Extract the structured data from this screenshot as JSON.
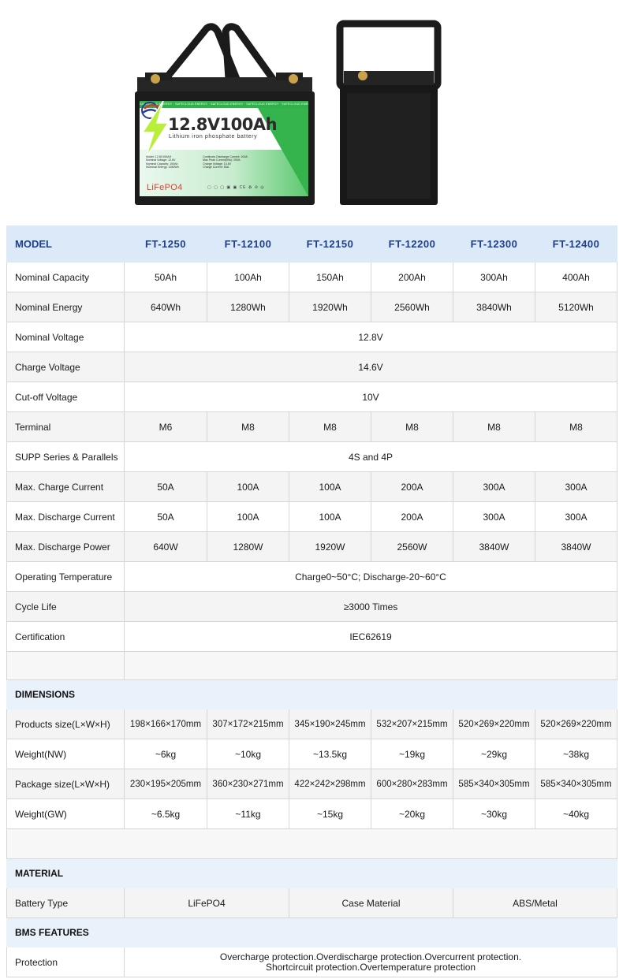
{
  "product": {
    "label_strip": "SAFECLOUD ENERGY · SAFECLOUD ENERGY · SAFECLOUD ENERGY · SAFECLOUD ENERGY · SAFECLOUD ENERGY · SAFECLOUD ENERGY",
    "title": "12.8V100Ah",
    "subtitle": "Lithium iron phosphate battery",
    "specs_left": [
      "Model:  12.8V100AH",
      "Nominal Voltage:  12.8V",
      "Nominal Capacity:  100Ah",
      "NOminal Energy:  1280Wh"
    ],
    "specs_right": [
      "Continues Discharge Current:  100A",
      "Max Peak Current(05s):  200A",
      "Charge Voltage:  14.6V",
      "Charge Current:  50A"
    ],
    "chemistry": "LiFePO4",
    "cert_marks": "▢ ▢ ▢  ▣ ▣ CE ♻ ⊘ ◎"
  },
  "header": {
    "label": "MODEL",
    "models": [
      "FT-1250",
      "FT-12100",
      "FT-12150",
      "FT-12200",
      "FT-12300",
      "FT-12400"
    ]
  },
  "rows": [
    {
      "label": "Nominal Capacity",
      "values": [
        "50Ah",
        "100Ah",
        "150Ah",
        "200Ah",
        "300Ah",
        "400Ah"
      ]
    },
    {
      "label": "Nominal Energy",
      "values": [
        "640Wh",
        "1280Wh",
        "1920Wh",
        "2560Wh",
        "3840Wh",
        "5120Wh"
      ]
    },
    {
      "label": "Nominal Voltage",
      "value": "12.8V"
    },
    {
      "label": "Charge Voltage",
      "value": "14.6V"
    },
    {
      "label": "Cut-off Voltage",
      "value": "10V"
    },
    {
      "label": "Terminal",
      "values": [
        "M6",
        "M8",
        "M8",
        "M8",
        "M8",
        "M8"
      ]
    },
    {
      "label": "SUPP Series & Parallels",
      "value": "4S and 4P"
    },
    {
      "label": "Max. Charge Current",
      "values": [
        "50A",
        "100A",
        "100A",
        "200A",
        "300A",
        "300A"
      ]
    },
    {
      "label": "Max. Discharge Current",
      "values": [
        "50A",
        "100A",
        "100A",
        "200A",
        "300A",
        "300A"
      ]
    },
    {
      "label": "Max. Discharge Power",
      "values": [
        "640W",
        "1280W",
        "1920W",
        "2560W",
        "3840W",
        "3840W"
      ]
    },
    {
      "label": "Operating Temperature",
      "value": "Charge0~50°C; Discharge-20~60°C"
    },
    {
      "label": "Cycle Life",
      "value": "≥3000 Times"
    },
    {
      "label": "Certification",
      "value": "IEC62619"
    }
  ],
  "dimensions": {
    "title": "DIMENSIONS",
    "rows": [
      {
        "label": "Products size(L×W×H)",
        "values": [
          "198×166×170mm",
          "307×172×215mm",
          "345×190×245mm",
          "532×207×215mm",
          "520×269×220mm",
          "520×269×220mm"
        ]
      },
      {
        "label": "Weight(NW)",
        "values": [
          "~6kg",
          "~10kg",
          "~13.5kg",
          "~19kg",
          "~29kg",
          "~38kg"
        ]
      },
      {
        "label": "Package size(L×W×H)",
        "values": [
          "230×195×205mm",
          "360×230×271mm",
          "422×242×298mm",
          "600×280×283mm",
          "585×340×305mm",
          "585×340×305mm"
        ]
      },
      {
        "label": "Weight(GW)",
        "values": [
          "~6.5kg",
          "~11kg",
          "~15kg",
          "~20kg",
          "~30kg",
          "~40kg"
        ]
      }
    ]
  },
  "material": {
    "title": "MATERIAL",
    "battery_type_label": "Battery Type",
    "battery_type_value": "LiFePO4",
    "case_material_label": "Case Material",
    "case_material_value": "ABS/Metal"
  },
  "bms": {
    "title": "BMS FEATURES",
    "protection_label": "Protection",
    "protection_line1": "Overcharge protection.Overdischarge protection.Overcurrent protection.",
    "protection_line2": "Shortcircuit protection.Overtemperature protection"
  },
  "colors": {
    "header_bg": "#dbe9f8",
    "header_text": "#1d3f8f",
    "label_green": "#35b34c",
    "lifepo4_red": "#e23b2e"
  }
}
